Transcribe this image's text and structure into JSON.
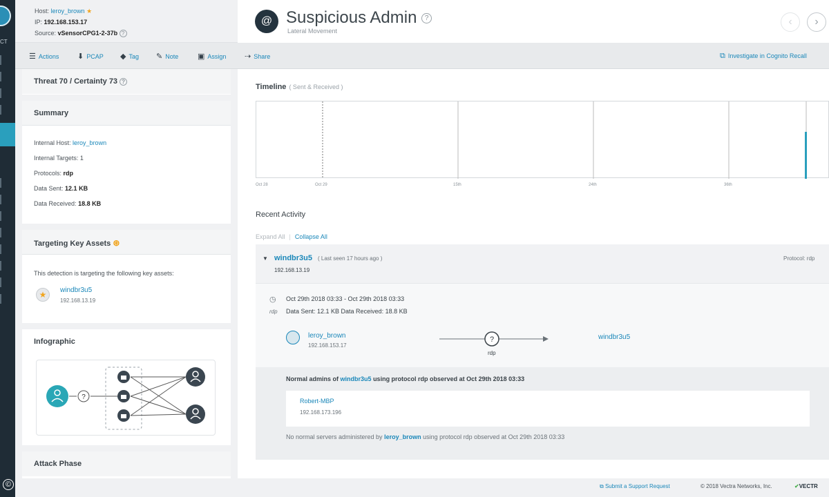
{
  "host": {
    "host_label": "Host:",
    "host_value": "leroy_brown",
    "ip_label": "IP:",
    "ip_value": "192.168.153.17",
    "source_label": "Source:",
    "source_value": "vSensorCPG1-2-37b"
  },
  "detection": {
    "title": "Suspicious Admin",
    "category": "Lateral Movement"
  },
  "actions": [
    "Actions",
    "PCAP",
    "Tag",
    "Note",
    "Assign",
    "Share"
  ],
  "investigate_link": "Investigate in Cognito Recall",
  "left": {
    "threat": "Threat 70 / Certainty 73",
    "summary_title": "Summary",
    "summary": [
      {
        "label": "Internal Host:",
        "value": "leroy_brown"
      },
      {
        "label": "Internal Targets:",
        "value": "1"
      },
      {
        "label": "Protocols:",
        "value": "rdp"
      },
      {
        "label": "Data Sent:",
        "value": "12.1 KB"
      },
      {
        "label": "Data Received:",
        "value": "18.8 KB"
      }
    ],
    "key_assets_title": "Targeting Key Assets",
    "key_assets_text": "This detection is targeting the following key assets:",
    "asset_name": "windbr3u5",
    "asset_ip": "192.168.13.19",
    "infographic_title": "Infographic",
    "attack_phase_title": "Attack Phase"
  },
  "timeline": {
    "title": "Timeline",
    "subtitle": "( Sent & Received )",
    "ticks": [
      "Oct 28",
      "Oct 29",
      "15th",
      "24th",
      "36th"
    ]
  },
  "activity": {
    "title": "Recent Activity",
    "expand_all": "Expand All",
    "collapse_all": "Collapse All",
    "target_name": "windbr3u5",
    "last_seen": "( Last seen 17 hours ago )",
    "target_ip": "192.168.13.19",
    "protocol": "Protocol: rdp",
    "time_range": "Oct 29th 2018 03:33 - Oct 29th 2018 03:33",
    "proto_short": "rdp",
    "data_line": "Data Sent: 12.1 KB   Data Received: 18.8 KB",
    "src_name": "leroy_brown",
    "src_ip": "192.168.153.17",
    "flow_proto": "rdp",
    "dst_name": "windbr3u5",
    "normal_pre": "Normal admins of",
    "normal_host": "windbr3u5",
    "normal_post": "using protocol rdp observed at Oct 29th 2018 03:33",
    "normal_admin_name": "Robert-MBP",
    "normal_admin_ip": "192.168.173.196",
    "no_servers_pre": "No normal servers administered by",
    "no_servers_host": "leroy_brown",
    "no_servers_post": "using protocol rdp observed at Oct 29th 2018 03:33"
  },
  "footer": {
    "support": "Submit a Support Request",
    "copyright": "© 2018 Vectra Networks, Inc.",
    "brand": "VECTR"
  },
  "brand_stub": "CT",
  "copyright_mark": "©"
}
